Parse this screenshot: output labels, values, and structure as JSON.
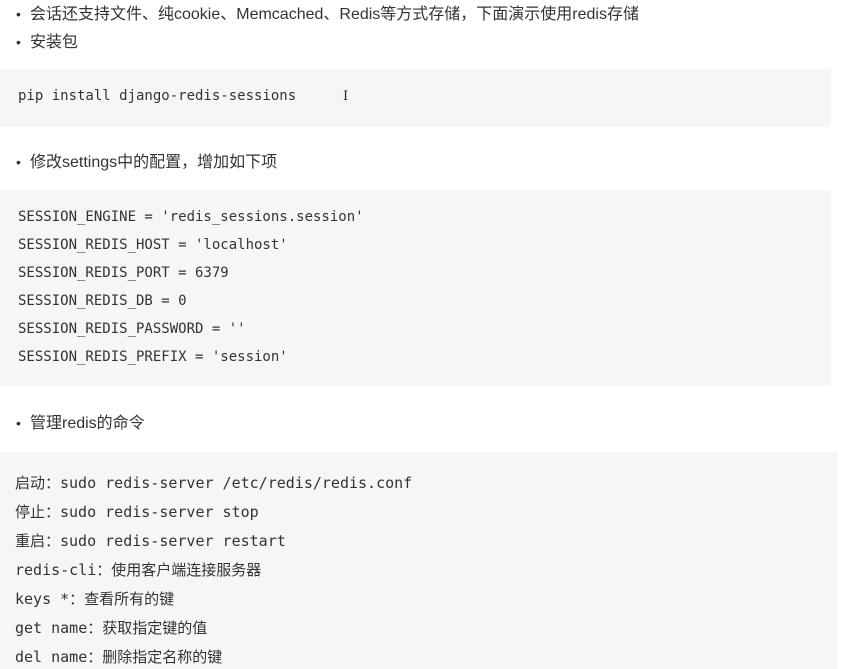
{
  "bullets": {
    "b1": "会话还支持文件、纯cookie、Memcached、Redis等方式存储，下面演示使用redis存储",
    "b2": "安装包",
    "b3": "修改settings中的配置，增加如下项",
    "b4": "管理redis的命令"
  },
  "bullet_char": "•",
  "cursor_char": "I",
  "code_install": [
    "pip install django-redis-sessions"
  ],
  "code_settings": [
    "SESSION_ENGINE = 'redis_sessions.session'",
    "SESSION_REDIS_HOST = 'localhost'",
    "SESSION_REDIS_PORT = 6379",
    "SESSION_REDIS_DB = 0",
    "SESSION_REDIS_PASSWORD = ''",
    "SESSION_REDIS_PREFIX = 'session'"
  ],
  "code_commands": [
    "启动：sudo redis-server /etc/redis/redis.conf",
    "停止：sudo redis-server stop",
    "重启：sudo redis-server restart",
    "redis-cli：使用客户端连接服务器",
    "keys *：查看所有的键",
    "get name：获取指定键的值",
    "del name：删除指定名称的键"
  ]
}
